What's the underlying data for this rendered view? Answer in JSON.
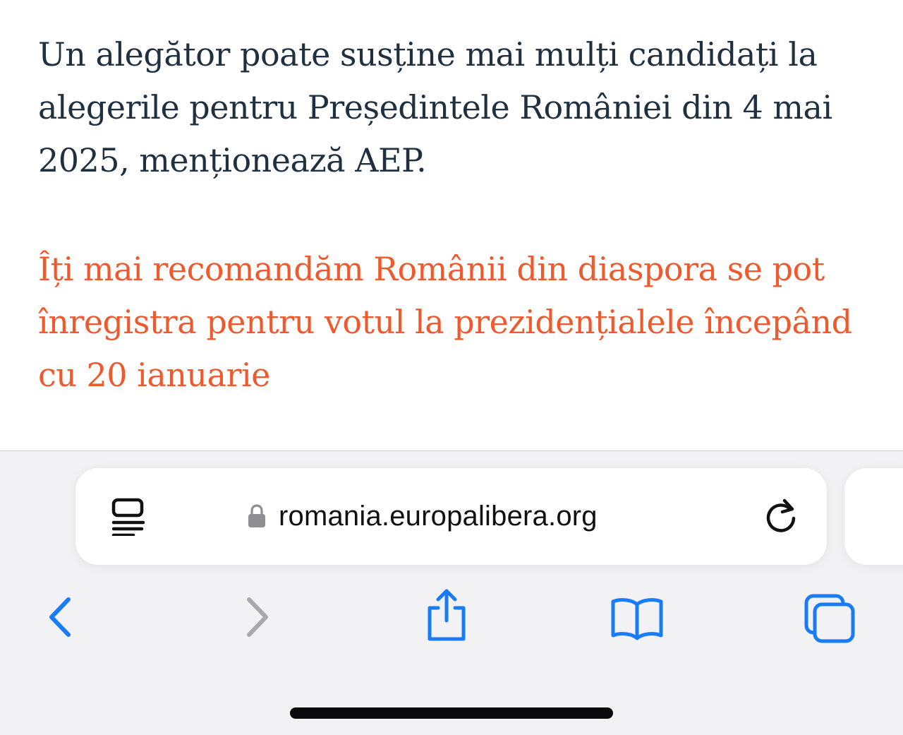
{
  "article": {
    "paragraph": "Un alegător poate susține mai mulți candidați la alegerile pentru Președintele României din 4 mai 2025, menționează AEP.",
    "recommendation_link": "Îți mai recomandăm Românii din diaspora se pot înregistra pentru votul la prezidențialele începând cu 20 ianuarie"
  },
  "browser": {
    "url": "romania.europalibera.org",
    "icons": {
      "reader": "reader-mode-icon",
      "lock": "lock-icon",
      "reload": "reload-icon",
      "back": "chevron-left-icon",
      "forward": "chevron-right-icon",
      "share": "share-icon",
      "bookmarks": "book-icon",
      "tabs": "tabs-icon"
    },
    "colors": {
      "accent": "#1a7cf5",
      "disabled": "#a8a8ad",
      "text": "#1f3140",
      "link": "#ee5a2e"
    }
  }
}
